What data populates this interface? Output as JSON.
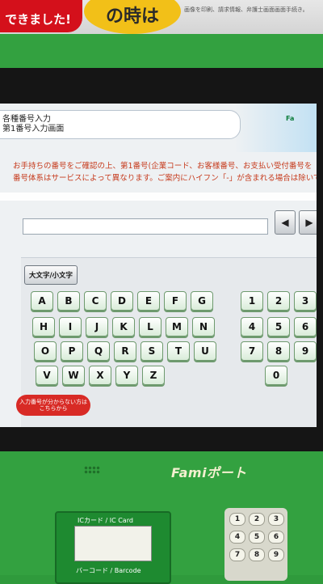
{
  "banner": {
    "left_text": "できました!",
    "center_text": "の時は",
    "right_text": "画像を印刷、請求情報、弁護士画面画面手続き。"
  },
  "screen": {
    "header_line1": "各種番号入力",
    "header_line2": "第1番号入力画面",
    "brand": "Fa",
    "instruction_line1": "お手持ちの番号をご確認の上、第1番号(企業コード、お客様番号、お支払い受付番号を",
    "instruction_line2": "番号体系はサービスによって異なります。ご案内にハイフン「-」が含まれる場合は除いて入力",
    "case_toggle": "大文字/小文字",
    "red_button": "入力番号が分からない方は\nこちらから",
    "arrow_left": "◀",
    "arrow_right": "▶",
    "letters_row1": [
      "A",
      "B",
      "C",
      "D",
      "E",
      "F",
      "G"
    ],
    "letters_row2": [
      "H",
      "I",
      "J",
      "K",
      "L",
      "M",
      "N"
    ],
    "letters_row3": [
      "O",
      "P",
      "Q",
      "R",
      "S",
      "T",
      "U"
    ],
    "letters_row4": [
      "V",
      "W",
      "X",
      "Y",
      "Z"
    ],
    "digits_row1": [
      "1",
      "2",
      "3"
    ],
    "digits_row2": [
      "4",
      "5",
      "6"
    ],
    "digits_row3": [
      "7",
      "8",
      "9"
    ],
    "digits_row4": [
      "0"
    ]
  },
  "device": {
    "logo": "Famiポート",
    "ic_card_label": "ICカード / IC Card",
    "barcode_label": "バーコード / Barcode",
    "pin_keys": [
      "1",
      "2",
      "3",
      "4",
      "5",
      "6",
      "7",
      "8",
      "9"
    ]
  }
}
